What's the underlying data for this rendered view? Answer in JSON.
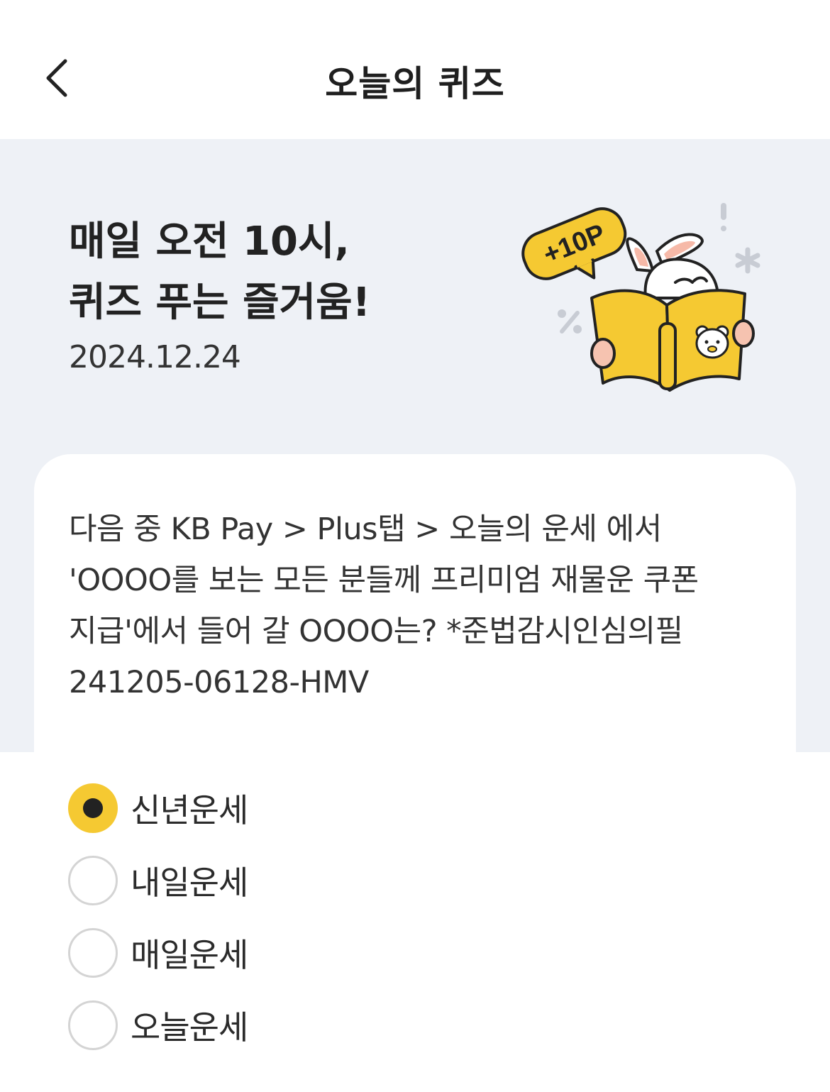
{
  "header": {
    "title": "오늘의 퀴즈",
    "back_icon": "chevron-left-icon"
  },
  "banner": {
    "headline_line1": "매일 오전 10시,",
    "headline_line2": "퀴즈 푸는 즐거움!",
    "date": "2024.12.24",
    "badge_text": "+10P",
    "colors": {
      "background": "#eef1f6",
      "accent_yellow": "#f5c932"
    }
  },
  "question": {
    "line1": "다음 중 KB Pay > Plus탭 > 오늘의 운세 에서",
    "line2": "'OOOO를 보는 모든 분들께 프리미엄 재물운 쿠폰",
    "line3": "지급'에서 들어 갈 OOOO는? *준법감시인심의필",
    "line4": "241205-06128-HMV"
  },
  "options": [
    {
      "label": "신년운세",
      "selected": true
    },
    {
      "label": "내일운세",
      "selected": false
    },
    {
      "label": "매일운세",
      "selected": false
    },
    {
      "label": "오늘운세",
      "selected": false
    }
  ]
}
